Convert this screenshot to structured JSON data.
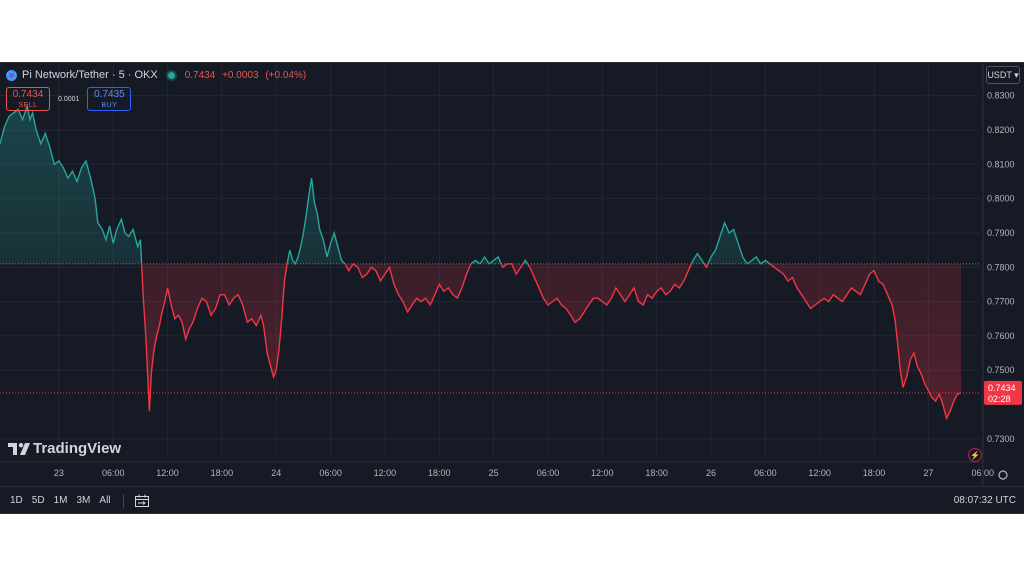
{
  "header": {
    "symbol": "Pi Network/Tether · 5 · OKX",
    "last_price": "0.7434",
    "change": "+0.0003",
    "change_pct": "(+0.04%)"
  },
  "trade": {
    "sell_price": "0.7434",
    "sell_label": "SELL",
    "spread": "0.0001",
    "buy_price": "0.7435",
    "buy_label": "BUY"
  },
  "currency_selector": "USDT ▾",
  "logo_text": "TradingView",
  "price_tag": {
    "value": "0.7434",
    "countdown": "02:28"
  },
  "bottom": {
    "ranges": [
      "1D",
      "5D",
      "1M",
      "3M",
      "All"
    ],
    "clock": "08:07:32 UTC"
  },
  "colors": {
    "up": "#26a69a",
    "down": "#f23645",
    "baseline": "#a0a3ad",
    "background": "#161a25"
  },
  "chart_data": {
    "type": "area",
    "style": "baseline",
    "baseline_value": 0.781,
    "last_value": 0.7434,
    "ylim": [
      0.725,
      0.834
    ],
    "y_ticks": [
      "0.8300",
      "0.8200",
      "0.8100",
      "0.8000",
      "0.7900",
      "0.7800",
      "0.7700",
      "0.7600",
      "0.7500",
      "0.7300"
    ],
    "x_ticks": [
      "23",
      "06:00",
      "12:00",
      "18:00",
      "24",
      "06:00",
      "12:00",
      "18:00",
      "25",
      "06:00",
      "12:00",
      "18:00",
      "26",
      "06:00",
      "12:00",
      "18:00",
      "27",
      "06:00"
    ],
    "x_range_hours": [
      -6.5,
      101.7
    ],
    "grid": true,
    "series": [
      {
        "points": [
          [
            -6.5,
            0.816
          ],
          [
            -6.0,
            0.821
          ],
          [
            -5.5,
            0.824
          ],
          [
            -5.0,
            0.825
          ],
          [
            -4.5,
            0.826
          ],
          [
            -4.0,
            0.823
          ],
          [
            -3.5,
            0.827
          ],
          [
            -3.2,
            0.823
          ],
          [
            -2.9,
            0.825
          ],
          [
            -2.5,
            0.82
          ],
          [
            -2.0,
            0.816
          ],
          [
            -1.5,
            0.819
          ],
          [
            -1.0,
            0.815
          ],
          [
            -0.5,
            0.81
          ],
          [
            0.0,
            0.811
          ],
          [
            0.5,
            0.809
          ],
          [
            1.0,
            0.806
          ],
          [
            1.5,
            0.808
          ],
          [
            2.0,
            0.805
          ],
          [
            2.5,
            0.809
          ],
          [
            3.0,
            0.811
          ],
          [
            3.5,
            0.806
          ],
          [
            4.0,
            0.8
          ],
          [
            4.3,
            0.793
          ],
          [
            4.8,
            0.791
          ],
          [
            5.2,
            0.788
          ],
          [
            5.6,
            0.792
          ],
          [
            6.0,
            0.787
          ],
          [
            6.4,
            0.791
          ],
          [
            6.9,
            0.794
          ],
          [
            7.3,
            0.79
          ],
          [
            7.7,
            0.789
          ],
          [
            8.2,
            0.791
          ],
          [
            8.7,
            0.786
          ],
          [
            9.0,
            0.788
          ],
          [
            9.1,
            0.783
          ],
          [
            9.3,
            0.772
          ],
          [
            9.6,
            0.76
          ],
          [
            9.8,
            0.749
          ],
          [
            10.0,
            0.738
          ],
          [
            10.2,
            0.749
          ],
          [
            10.5,
            0.756
          ],
          [
            10.8,
            0.76
          ],
          [
            11.1,
            0.763
          ],
          [
            11.4,
            0.767
          ],
          [
            11.7,
            0.77
          ],
          [
            12.0,
            0.774
          ],
          [
            12.4,
            0.769
          ],
          [
            12.8,
            0.765
          ],
          [
            13.2,
            0.766
          ],
          [
            13.6,
            0.764
          ],
          [
            14.0,
            0.759
          ],
          [
            14.4,
            0.762
          ],
          [
            14.8,
            0.764
          ],
          [
            15.3,
            0.768
          ],
          [
            15.8,
            0.771
          ],
          [
            16.3,
            0.77
          ],
          [
            16.8,
            0.766
          ],
          [
            17.3,
            0.768
          ],
          [
            17.8,
            0.772
          ],
          [
            18.3,
            0.772
          ],
          [
            18.8,
            0.769
          ],
          [
            19.3,
            0.771
          ],
          [
            19.8,
            0.772
          ],
          [
            20.3,
            0.769
          ],
          [
            20.8,
            0.764
          ],
          [
            21.3,
            0.765
          ],
          [
            21.8,
            0.763
          ],
          [
            22.3,
            0.766
          ],
          [
            22.6,
            0.763
          ],
          [
            23.0,
            0.755
          ],
          [
            23.4,
            0.751
          ],
          [
            23.7,
            0.748
          ],
          [
            24.0,
            0.75
          ],
          [
            24.3,
            0.756
          ],
          [
            24.6,
            0.765
          ],
          [
            24.9,
            0.776
          ],
          [
            25.2,
            0.781
          ],
          [
            25.5,
            0.785
          ],
          [
            25.8,
            0.782
          ],
          [
            26.1,
            0.781
          ],
          [
            26.4,
            0.783
          ],
          [
            26.7,
            0.786
          ],
          [
            27.0,
            0.79
          ],
          [
            27.3,
            0.795
          ],
          [
            27.6,
            0.801
          ],
          [
            27.9,
            0.806
          ],
          [
            28.2,
            0.799
          ],
          [
            28.5,
            0.796
          ],
          [
            28.8,
            0.791
          ],
          [
            29.2,
            0.788
          ],
          [
            29.6,
            0.783
          ],
          [
            30.0,
            0.787
          ],
          [
            30.4,
            0.79
          ],
          [
            30.8,
            0.786
          ],
          [
            31.2,
            0.782
          ],
          [
            31.6,
            0.781
          ],
          [
            32.0,
            0.779
          ],
          [
            32.5,
            0.781
          ],
          [
            33.0,
            0.78
          ],
          [
            33.5,
            0.777
          ],
          [
            34.0,
            0.778
          ],
          [
            34.5,
            0.78
          ],
          [
            35.0,
            0.779
          ],
          [
            35.5,
            0.776
          ],
          [
            36.0,
            0.778
          ],
          [
            36.5,
            0.78
          ],
          [
            37.0,
            0.775
          ],
          [
            37.5,
            0.772
          ],
          [
            38.0,
            0.77
          ],
          [
            38.5,
            0.767
          ],
          [
            39.0,
            0.769
          ],
          [
            39.5,
            0.771
          ],
          [
            40.0,
            0.77
          ],
          [
            40.5,
            0.771
          ],
          [
            41.0,
            0.769
          ],
          [
            41.5,
            0.772
          ],
          [
            42.0,
            0.775
          ],
          [
            42.5,
            0.773
          ],
          [
            43.0,
            0.774
          ],
          [
            43.5,
            0.772
          ],
          [
            44.0,
            0.771
          ],
          [
            44.5,
            0.774
          ],
          [
            45.0,
            0.778
          ],
          [
            45.5,
            0.781
          ],
          [
            46.0,
            0.782
          ],
          [
            46.5,
            0.781
          ],
          [
            47.0,
            0.783
          ],
          [
            47.5,
            0.781
          ],
          [
            48.0,
            0.782
          ],
          [
            48.5,
            0.783
          ],
          [
            49.0,
            0.78
          ],
          [
            49.5,
            0.781
          ],
          [
            50.0,
            0.781
          ],
          [
            50.5,
            0.778
          ],
          [
            51.0,
            0.78
          ],
          [
            51.5,
            0.782
          ],
          [
            52.0,
            0.78
          ],
          [
            52.5,
            0.777
          ],
          [
            53.0,
            0.774
          ],
          [
            53.5,
            0.771
          ],
          [
            54.0,
            0.769
          ],
          [
            54.5,
            0.77
          ],
          [
            55.0,
            0.771
          ],
          [
            55.5,
            0.769
          ],
          [
            56.0,
            0.768
          ],
          [
            56.5,
            0.766
          ],
          [
            57.0,
            0.764
          ],
          [
            57.5,
            0.765
          ],
          [
            58.0,
            0.767
          ],
          [
            58.5,
            0.769
          ],
          [
            59.0,
            0.771
          ],
          [
            59.5,
            0.771
          ],
          [
            60.0,
            0.77
          ],
          [
            60.5,
            0.769
          ],
          [
            61.0,
            0.771
          ],
          [
            61.5,
            0.774
          ],
          [
            62.0,
            0.772
          ],
          [
            62.5,
            0.77
          ],
          [
            63.0,
            0.772
          ],
          [
            63.5,
            0.774
          ],
          [
            64.0,
            0.77
          ],
          [
            64.5,
            0.769
          ],
          [
            65.0,
            0.772
          ],
          [
            65.5,
            0.771
          ],
          [
            66.0,
            0.773
          ],
          [
            66.5,
            0.774
          ],
          [
            67.0,
            0.772
          ],
          [
            67.5,
            0.773
          ],
          [
            68.0,
            0.775
          ],
          [
            68.5,
            0.774
          ],
          [
            69.0,
            0.776
          ],
          [
            69.5,
            0.779
          ],
          [
            70.0,
            0.782
          ],
          [
            70.5,
            0.784
          ],
          [
            71.0,
            0.782
          ],
          [
            71.5,
            0.78
          ],
          [
            72.0,
            0.783
          ],
          [
            72.5,
            0.785
          ],
          [
            73.0,
            0.789
          ],
          [
            73.5,
            0.793
          ],
          [
            74.0,
            0.79
          ],
          [
            74.5,
            0.791
          ],
          [
            75.0,
            0.787
          ],
          [
            75.5,
            0.783
          ],
          [
            76.0,
            0.781
          ],
          [
            76.5,
            0.782
          ],
          [
            77.0,
            0.783
          ],
          [
            77.5,
            0.781
          ],
          [
            78.0,
            0.782
          ],
          [
            78.5,
            0.781
          ],
          [
            79.0,
            0.78
          ],
          [
            79.5,
            0.779
          ],
          [
            80.0,
            0.778
          ],
          [
            80.5,
            0.776
          ],
          [
            81.0,
            0.777
          ],
          [
            81.5,
            0.774
          ],
          [
            82.0,
            0.772
          ],
          [
            82.5,
            0.77
          ],
          [
            83.0,
            0.768
          ],
          [
            83.5,
            0.769
          ],
          [
            84.0,
            0.77
          ],
          [
            84.5,
            0.771
          ],
          [
            85.0,
            0.77
          ],
          [
            85.5,
            0.772
          ],
          [
            86.0,
            0.771
          ],
          [
            86.5,
            0.77
          ],
          [
            87.0,
            0.772
          ],
          [
            87.5,
            0.774
          ],
          [
            88.0,
            0.773
          ],
          [
            88.5,
            0.772
          ],
          [
            89.0,
            0.775
          ],
          [
            89.5,
            0.778
          ],
          [
            90.0,
            0.779
          ],
          [
            90.5,
            0.776
          ],
          [
            91.0,
            0.775
          ],
          [
            91.5,
            0.772
          ],
          [
            92.0,
            0.769
          ],
          [
            92.3,
            0.765
          ],
          [
            92.6,
            0.758
          ],
          [
            92.9,
            0.75
          ],
          [
            93.2,
            0.745
          ],
          [
            93.6,
            0.748
          ],
          [
            94.0,
            0.753
          ],
          [
            94.4,
            0.755
          ],
          [
            94.8,
            0.751
          ],
          [
            95.2,
            0.749
          ],
          [
            95.6,
            0.746
          ],
          [
            96.0,
            0.744
          ],
          [
            96.4,
            0.742
          ],
          [
            96.8,
            0.741
          ],
          [
            97.2,
            0.743
          ],
          [
            97.6,
            0.74
          ],
          [
            98.0,
            0.736
          ],
          [
            98.4,
            0.738
          ],
          [
            98.8,
            0.741
          ],
          [
            99.2,
            0.743
          ],
          [
            99.6,
            0.7434
          ]
        ]
      }
    ]
  }
}
